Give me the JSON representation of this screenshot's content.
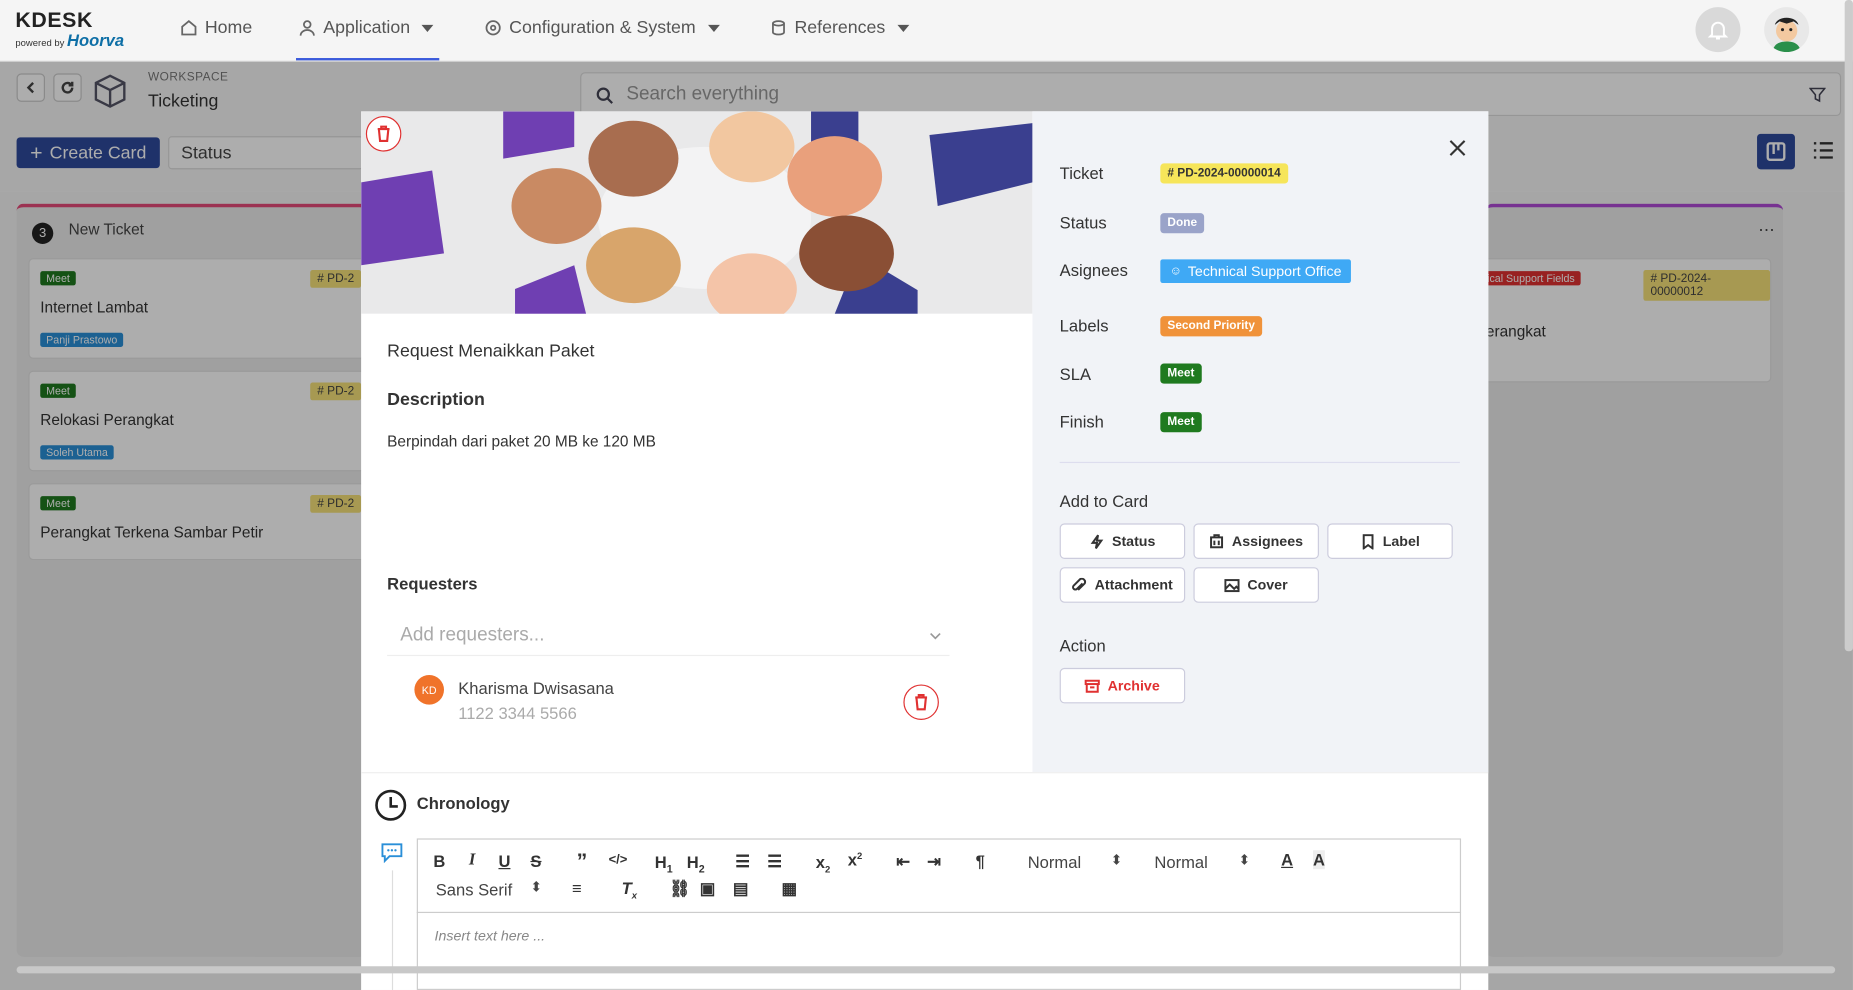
{
  "app": {
    "logo": "KDESK",
    "powered": "powered by",
    "brand": "Hoorva"
  },
  "nav": {
    "home": "Home",
    "application": "Application",
    "config": "Configuration & System",
    "references": "References"
  },
  "workspace": {
    "label": "WORKSPACE",
    "value": "Ticketing"
  },
  "search": {
    "placeholder": "Search everything"
  },
  "toolbar": {
    "create": "Create Card",
    "status": "Status"
  },
  "board": {
    "column": {
      "count": "3",
      "title": "New Ticket"
    },
    "cards": [
      {
        "sla": "Meet",
        "pd": "# PD-2",
        "title": "Internet Lambat",
        "person": "Panji Prastowo"
      },
      {
        "sla": "Meet",
        "pd": "# PD-2",
        "title": "Relokasi Perangkat",
        "person": "Soleh Utama"
      },
      {
        "sla": "Meet",
        "pd": "# PD-2",
        "title": "Perangkat Terkena Sambar Petir",
        "person": ""
      }
    ],
    "right_card": {
      "tag": "ical Support Fields",
      "pd": "# PD-2024-00000012",
      "title": "erangkat"
    }
  },
  "modal": {
    "title": "Request Menaikkan Paket",
    "description_label": "Description",
    "description": "Berpindah dari paket 20 MB ke 120 MB",
    "requesters_label": "Requesters",
    "requesters_placeholder": "Add requesters...",
    "requester": {
      "initials": "KD",
      "name": "Kharisma Dwisasana",
      "phone": "1122 3344 5566"
    },
    "fields": {
      "ticket_label": "Ticket",
      "ticket": "# PD-2024-00000014",
      "status_label": "Status",
      "status": "Done",
      "assignees_label": "Asignees",
      "assignees": "Technical Support Office",
      "labels_label": "Labels",
      "labels": "Second Priority",
      "sla_label": "SLA",
      "sla": "Meet",
      "finish_label": "Finish",
      "finish": "Meet"
    },
    "add_to_card": "Add to Card",
    "buttons": {
      "status": "Status",
      "assignees": "Assignees",
      "label": "Label",
      "attachment": "Attachment",
      "cover": "Cover"
    },
    "action_label": "Action",
    "archive": "Archive",
    "chronology": "Chronology",
    "editor": {
      "normal1": "Normal",
      "normal2": "Normal",
      "font": "Sans Serif",
      "placeholder": "Insert text here ..."
    }
  },
  "colors": {
    "accent": "#2f4a9c",
    "done": "#9aa3c9",
    "assignee": "#3fa9f5",
    "priority": "#f0923a",
    "meet": "#1f7a1f",
    "danger": "#e03131"
  }
}
